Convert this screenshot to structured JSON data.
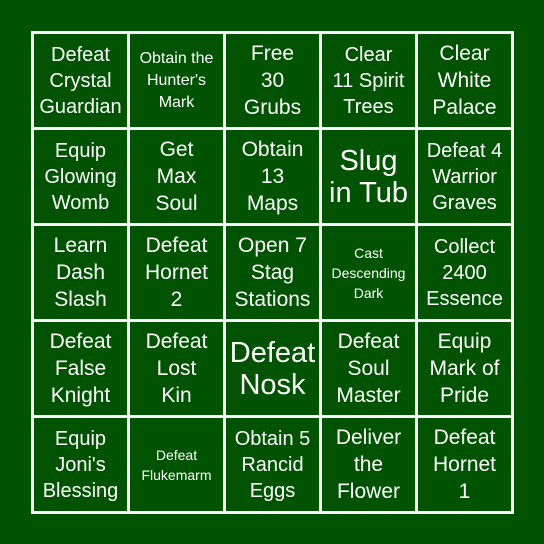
{
  "board": {
    "background_color": "#005300",
    "line_color": "#ffffff",
    "text_color": "#ffffff",
    "cells": [
      {
        "label": "Defeat\nCrystal\nGuardian",
        "size": "s-mds"
      },
      {
        "label": "Obtain the\nHunter's\nMark",
        "size": "s-sm"
      },
      {
        "label": "Free\n30\nGrubs",
        "size": "s-md"
      },
      {
        "label": "Clear\n11 Spirit\nTrees",
        "size": "s-mds"
      },
      {
        "label": "Clear\nWhite\nPalace",
        "size": "s-md"
      },
      {
        "label": "Equip\nGlowing\nWomb",
        "size": "s-mds"
      },
      {
        "label": "Get\nMax\nSoul",
        "size": "s-md"
      },
      {
        "label": "Obtain\n13\nMaps",
        "size": "s-md"
      },
      {
        "label": "Slug\nin Tub",
        "size": "s-lg"
      },
      {
        "label": "Defeat 4\nWarrior\nGraves",
        "size": "s-mds"
      },
      {
        "label": "Learn\nDash\nSlash",
        "size": "s-md"
      },
      {
        "label": "Defeat\nHornet\n2",
        "size": "s-md"
      },
      {
        "label": "Open 7\nStag\nStations",
        "size": "s-md"
      },
      {
        "label": "Cast\nDescending\nDark",
        "size": "s-xs"
      },
      {
        "label": "Collect\n2400\nEssence",
        "size": "s-mds"
      },
      {
        "label": "Defeat\nFalse\nKnight",
        "size": "s-md"
      },
      {
        "label": "Defeat\nLost\nKin",
        "size": "s-md"
      },
      {
        "label": "Defeat\nNosk",
        "size": "s-lg"
      },
      {
        "label": "Defeat\nSoul\nMaster",
        "size": "s-md"
      },
      {
        "label": "Equip\nMark of\nPride",
        "size": "s-md"
      },
      {
        "label": "Equip\nJoni's\nBlessing",
        "size": "s-mds"
      },
      {
        "label": "Defeat\nFlukemarm",
        "size": "s-xs"
      },
      {
        "label": "Obtain 5\nRancid\nEggs",
        "size": "s-mds"
      },
      {
        "label": "Deliver\nthe\nFlower",
        "size": "s-md"
      },
      {
        "label": "Defeat\nHornet\n1",
        "size": "s-md"
      }
    ]
  }
}
